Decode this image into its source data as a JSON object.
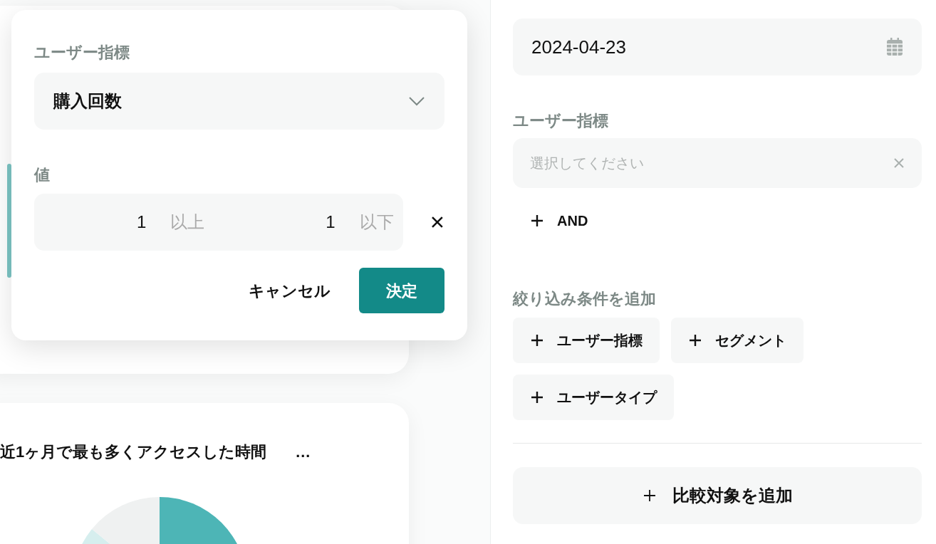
{
  "cards": [
    {
      "kind": "bar-card"
    },
    {
      "title": "近1ヶ月で最も多くアクセスした時間",
      "menu": "…"
    }
  ],
  "popover": {
    "title": "ユーザー指標",
    "select": {
      "value": "購入回数"
    },
    "value_label": "値",
    "range": {
      "min": "1",
      "min_suffix": "以上",
      "max": "1",
      "max_suffix": "以下"
    },
    "buttons": [
      {
        "label": "キャンセル",
        "kind": "secondary"
      },
      {
        "label": "決定",
        "kind": "primary"
      }
    ]
  },
  "panel": {
    "date": {
      "value": "2024-04-23"
    },
    "metric_label": "ユーザー指標",
    "metric_select": {
      "placeholder": "選択してください"
    },
    "and_button": "AND",
    "filter_label": "絞り込み条件を追加",
    "filter_buttons": [
      "ユーザー指標",
      "セグメント",
      "ユーザータイプ"
    ],
    "compare_button": "比較対象を追加"
  }
}
